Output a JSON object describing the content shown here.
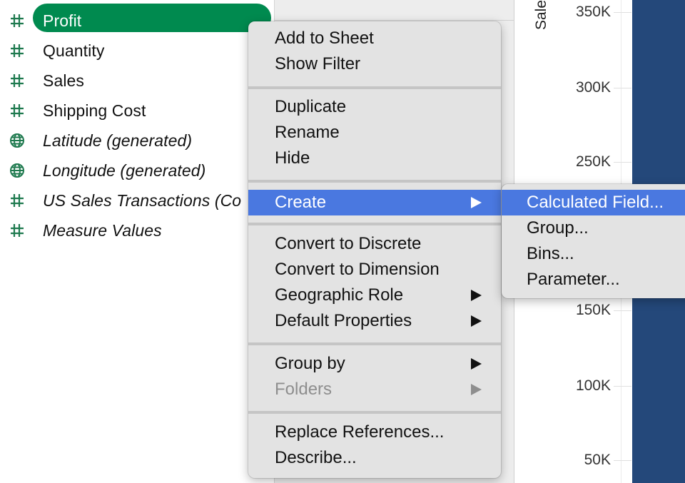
{
  "colors": {
    "accent_green": "#008a4f",
    "field_icon_green": "#1f7a4f",
    "menu_highlight": "#4a78e0",
    "bar_color": "#24487a",
    "menu_bg": "#e3e3e3"
  },
  "data_pane": {
    "fields": [
      {
        "label": "Profit",
        "icon": "number-hash-icon",
        "italic": false,
        "selected": true
      },
      {
        "label": "Quantity",
        "icon": "number-hash-icon",
        "italic": false,
        "selected": false
      },
      {
        "label": "Sales",
        "icon": "number-hash-icon",
        "italic": false,
        "selected": false
      },
      {
        "label": "Shipping Cost",
        "icon": "number-hash-icon",
        "italic": false,
        "selected": false
      },
      {
        "label": "Latitude (generated)",
        "icon": "globe-icon",
        "italic": true,
        "selected": false
      },
      {
        "label": "Longitude (generated)",
        "icon": "globe-icon",
        "italic": true,
        "selected": false
      },
      {
        "label": "US Sales Transactions (Co",
        "icon": "number-hash-icon",
        "italic": true,
        "selected": false
      },
      {
        "label": "Measure Values",
        "icon": "number-hash-icon",
        "italic": true,
        "selected": false
      }
    ]
  },
  "context_menu": {
    "items": [
      {
        "label": "Add to Sheet"
      },
      {
        "label": "Show Filter"
      },
      {
        "label": "Duplicate"
      },
      {
        "label": "Rename"
      },
      {
        "label": "Hide"
      },
      {
        "label": "Create",
        "submenu": true,
        "highlighted": true
      },
      {
        "label": "Convert to Discrete"
      },
      {
        "label": "Convert to Dimension"
      },
      {
        "label": "Geographic Role",
        "submenu": true
      },
      {
        "label": "Default Properties",
        "submenu": true
      },
      {
        "label": "Group by",
        "submenu": true
      },
      {
        "label": "Folders",
        "submenu": true,
        "disabled": true
      },
      {
        "label": "Replace References..."
      },
      {
        "label": "Describe..."
      }
    ]
  },
  "create_submenu": {
    "items": [
      {
        "label": "Calculated Field...",
        "highlighted": true
      },
      {
        "label": "Group..."
      },
      {
        "label": "Bins..."
      },
      {
        "label": "Parameter..."
      }
    ]
  },
  "chart": {
    "axis_title": "Sales",
    "tick_labels": [
      "350K",
      "300K",
      "250K",
      "150K",
      "100K",
      "50K"
    ]
  },
  "chart_data": {
    "type": "bar",
    "ylabel": "Sales",
    "yticks": [
      "50K",
      "100K",
      "150K",
      "250K",
      "300K",
      "350K"
    ],
    "series": [
      {
        "name": "Sales",
        "values": [
          ">=350000 (bar extends beyond visible range)"
        ]
      }
    ],
    "grid": true
  }
}
